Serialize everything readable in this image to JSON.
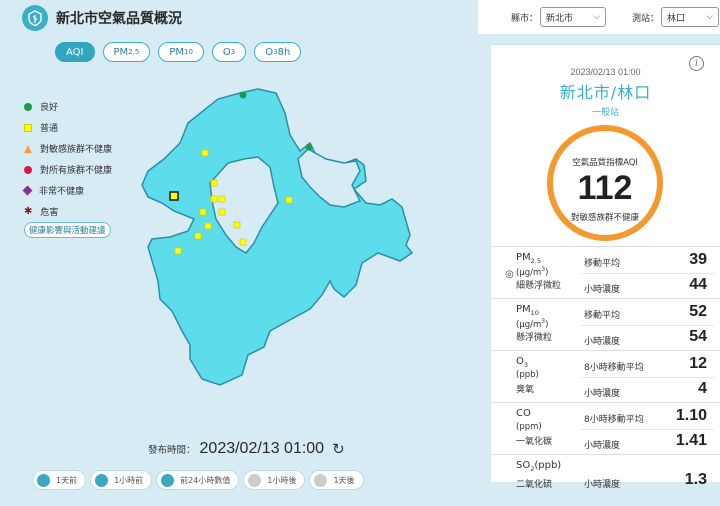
{
  "header": {
    "title": "新北市空氣品質概況"
  },
  "tabs": [
    {
      "label": "AQI",
      "sub": "",
      "active": true
    },
    {
      "label": "PM",
      "sub": "2.5",
      "active": false
    },
    {
      "label": "PM",
      "sub": "10",
      "active": false
    },
    {
      "label": "O",
      "sub": "3",
      "active": false
    },
    {
      "label": "O",
      "sub": "3",
      "suffix": " 8h",
      "active": false
    }
  ],
  "legend": [
    {
      "label": "良好",
      "color": "#1e9a4d",
      "shape": "circle"
    },
    {
      "label": "普通",
      "color": "#ffff00",
      "shape": "square"
    },
    {
      "label": "對敏感族群不健康",
      "color": "#ff9e3c",
      "shape": "triangle"
    },
    {
      "label": "對所有族群不健康",
      "color": "#e0174a",
      "shape": "circle"
    },
    {
      "label": "非常不健康",
      "color": "#8e2a9c",
      "shape": "diamond"
    },
    {
      "label": "危害",
      "color": "#7e1f2e",
      "shape": "star"
    }
  ],
  "health_link": "健康影響與活動建議",
  "publish": {
    "label": "發布時間：",
    "value": "2023/02/13 01:00"
  },
  "timebar": [
    {
      "label": "1天前",
      "active": true
    },
    {
      "label": "1小時前",
      "active": true
    },
    {
      "label": "前24小時數值",
      "active": true
    },
    {
      "label": "1小時後",
      "active": false
    },
    {
      "label": "1天後",
      "active": false
    }
  ],
  "selectors": {
    "county_label": "縣市：",
    "county_value": "新北市",
    "station_label": "測站：",
    "station_value": "林口"
  },
  "card": {
    "time": "2023/02/13 01:00",
    "station": "新北市/林口",
    "station_type": "一般站",
    "aqi_label": "空氣品質指標AQI",
    "aqi_value": "112",
    "aqi_status": "對敏感族群不健康"
  },
  "pollutants": [
    {
      "name": "PM",
      "sub": "2.5",
      "unit": "(μg/m",
      "unit_sup": "3",
      "unit_end": ")",
      "desc": "細懸浮微粒",
      "label1": "移動平均",
      "value1": "39",
      "label2": "小時濃度",
      "value2": "44",
      "target": true
    },
    {
      "name": "PM",
      "sub": "10",
      "unit": "(μg/m",
      "unit_sup": "3",
      "unit_end": ")",
      "desc": "懸浮微粒",
      "label1": "移動平均",
      "value1": "52",
      "label2": "小時濃度",
      "value2": "54",
      "target": false
    },
    {
      "name": "O",
      "sub": "3",
      "unit": "(ppb)",
      "unit_sup": "",
      "unit_end": "",
      "desc": "臭氧",
      "label1": "8小時移動平均",
      "value1": "12",
      "label2": "小時濃度",
      "value2": "4",
      "target": false
    },
    {
      "name": "CO",
      "sub": "",
      "unit": "(ppm)",
      "unit_sup": "",
      "unit_end": "",
      "desc": "一氧化碳",
      "label1": "8小時移動平均",
      "value1": "1.10",
      "label2": "小時濃度",
      "value2": "1.41",
      "target": false
    },
    {
      "name": "SO",
      "sub": "2",
      "unit": "",
      "unit_sup": "",
      "unit_end": "",
      "name_suffix": "(ppb)",
      "desc": "二氧化硫",
      "label1": "",
      "value1": "",
      "label2": "小時濃度",
      "value2": "1.3",
      "target": false
    }
  ],
  "map": {
    "land_color": "#5ddcec",
    "border_color": "#2a8fa6",
    "stations": [
      {
        "status": "good"
      },
      {
        "status": "good"
      },
      {
        "status": "moderate"
      },
      {
        "status": "moderate"
      },
      {
        "status": "moderate"
      },
      {
        "status": "moderate"
      },
      {
        "status": "moderate"
      },
      {
        "status": "moderate"
      },
      {
        "status": "moderate"
      },
      {
        "status": "moderate"
      },
      {
        "status": "moderate"
      },
      {
        "status": "moderate"
      },
      {
        "status": "moderate"
      },
      {
        "status": "moderate",
        "selected": true
      }
    ]
  }
}
